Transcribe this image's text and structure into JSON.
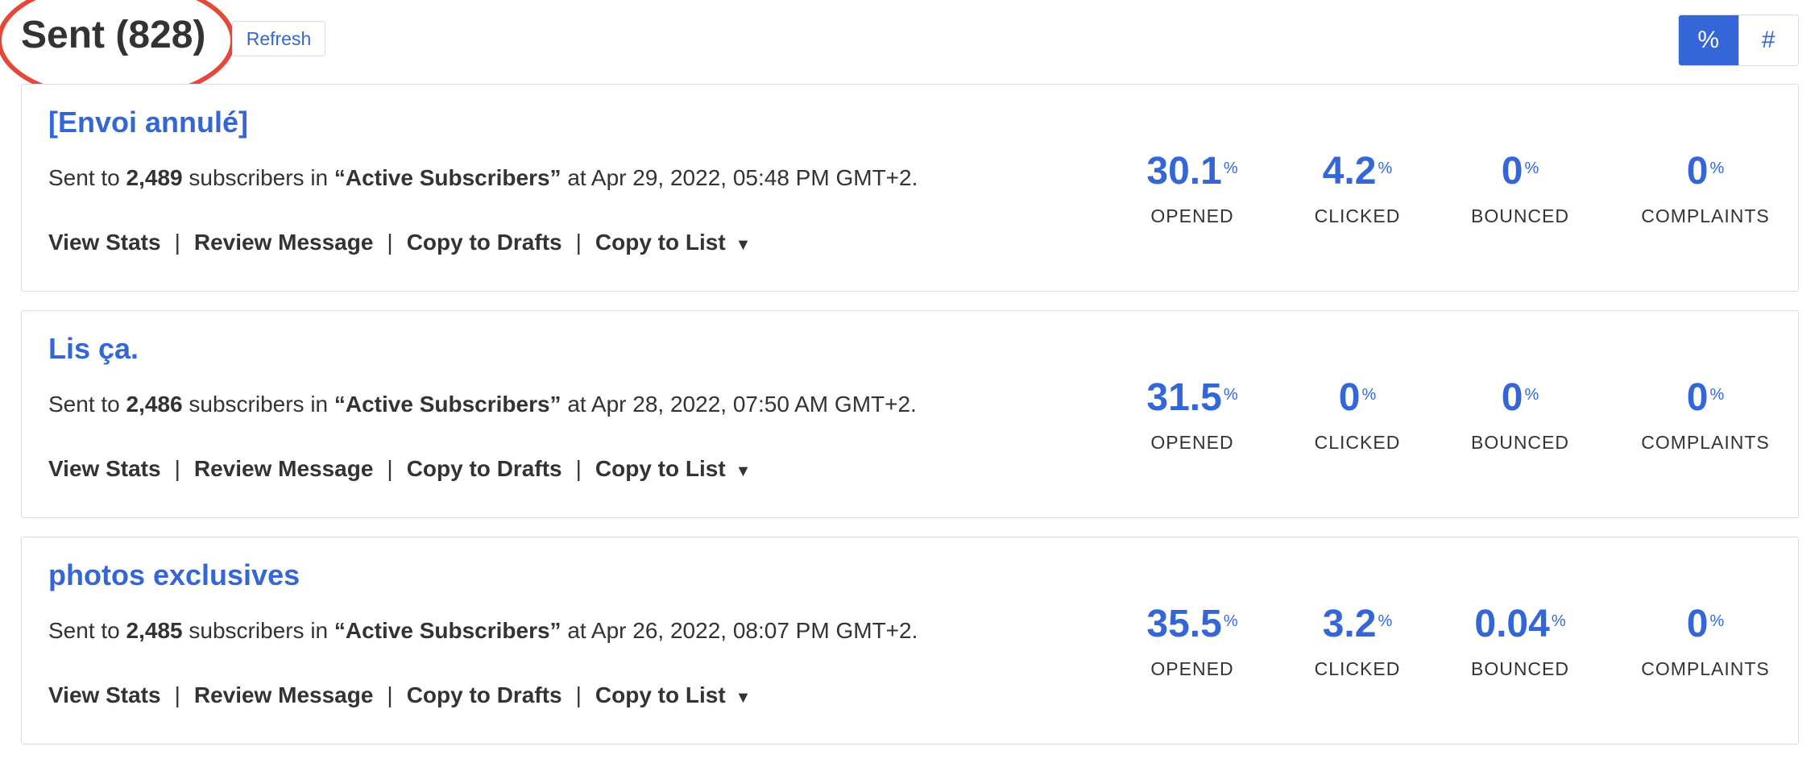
{
  "header": {
    "title": "Sent (828)",
    "refresh_label": "Refresh",
    "toggle": {
      "percent_label": "%",
      "count_label": "#",
      "active": "%"
    }
  },
  "colors": {
    "accent": "#3466d8",
    "highlight_ring": "#e54738",
    "text": "#333333",
    "border": "#d9dce1"
  },
  "campaigns": [
    {
      "title": "[Envoi annulé]",
      "desc_prefix": "Sent to",
      "subscribers": "2,489",
      "desc_mid": "subscribers in",
      "list_name": "“Active Subscribers”",
      "desc_suffix": "at Apr 29, 2022, 05:48 PM GMT+2.",
      "actions": {
        "view_stats": "View Stats",
        "review": "Review Message",
        "copy_drafts": "Copy to Drafts",
        "copy_list": "Copy to List"
      },
      "stats": {
        "opened": {
          "value": "30.1",
          "unit": "%",
          "label": "OPENED"
        },
        "clicked": {
          "value": "4.2",
          "unit": "%",
          "label": "CLICKED"
        },
        "bounced": {
          "value": "0",
          "unit": "%",
          "label": "BOUNCED"
        },
        "complaints": {
          "value": "0",
          "unit": "%",
          "label": "COMPLAINTS"
        }
      }
    },
    {
      "title": "Lis ça.",
      "desc_prefix": "Sent to",
      "subscribers": "2,486",
      "desc_mid": "subscribers in",
      "list_name": "“Active Subscribers”",
      "desc_suffix": "at Apr 28, 2022, 07:50 AM GMT+2.",
      "actions": {
        "view_stats": "View Stats",
        "review": "Review Message",
        "copy_drafts": "Copy to Drafts",
        "copy_list": "Copy to List"
      },
      "stats": {
        "opened": {
          "value": "31.5",
          "unit": "%",
          "label": "OPENED"
        },
        "clicked": {
          "value": "0",
          "unit": "%",
          "label": "CLICKED"
        },
        "bounced": {
          "value": "0",
          "unit": "%",
          "label": "BOUNCED"
        },
        "complaints": {
          "value": "0",
          "unit": "%",
          "label": "COMPLAINTS"
        }
      }
    },
    {
      "title": "photos exclusives",
      "desc_prefix": "Sent to",
      "subscribers": "2,485",
      "desc_mid": "subscribers in",
      "list_name": "“Active Subscribers”",
      "desc_suffix": "at Apr 26, 2022, 08:07 PM GMT+2.",
      "actions": {
        "view_stats": "View Stats",
        "review": "Review Message",
        "copy_drafts": "Copy to Drafts",
        "copy_list": "Copy to List"
      },
      "stats": {
        "opened": {
          "value": "35.5",
          "unit": "%",
          "label": "OPENED"
        },
        "clicked": {
          "value": "3.2",
          "unit": "%",
          "label": "CLICKED"
        },
        "bounced": {
          "value": "0.04",
          "unit": "%",
          "label": "BOUNCED"
        },
        "complaints": {
          "value": "0",
          "unit": "%",
          "label": "COMPLAINTS"
        }
      }
    }
  ]
}
